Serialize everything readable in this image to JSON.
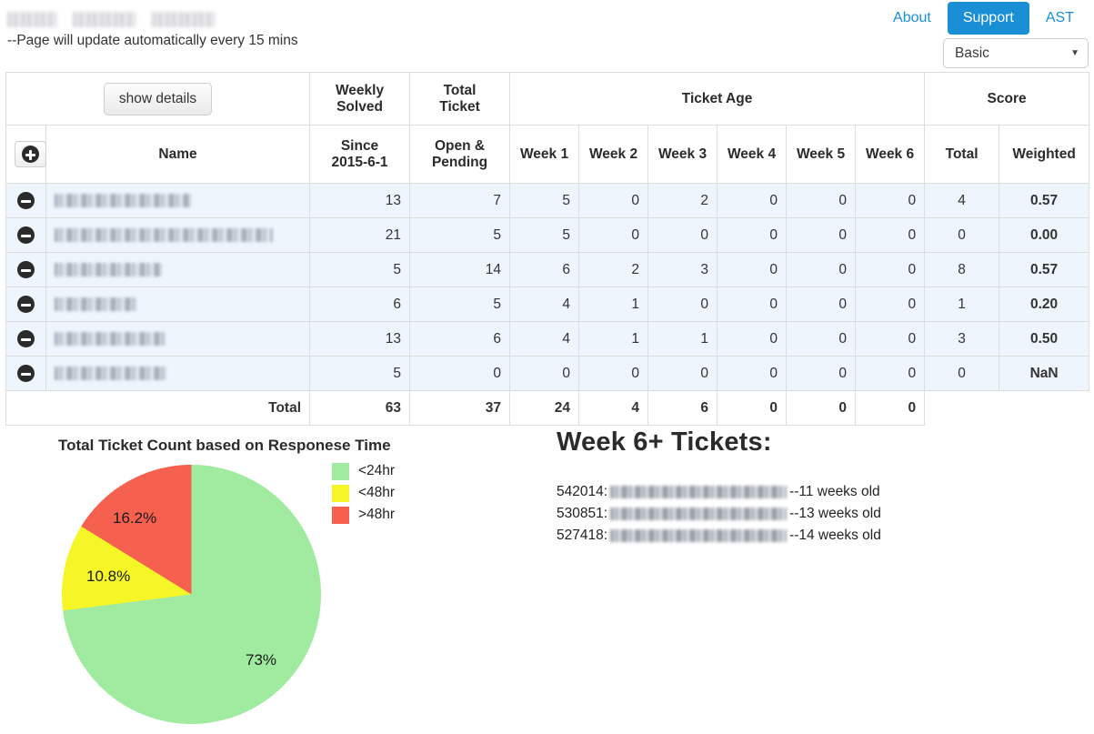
{
  "header": {
    "brand_redacted": true,
    "subnote": "--Page will update automatically every 15 mins",
    "nav": {
      "about": "About",
      "support": "Support",
      "ast": "AST"
    },
    "view_select": {
      "value": "Basic",
      "options": [
        "Basic"
      ],
      "caret": "▼"
    },
    "accent_color": "#1b8fd6"
  },
  "table": {
    "show_details_label": "show details",
    "expand_icon": "plus-circle-icon",
    "group_headers": {
      "weekly_solved": "Weekly\nSolved",
      "total_ticket": "Total\nTicket",
      "ticket_age": "Ticket Age",
      "score": "Score"
    },
    "group_headers_flat": {
      "weekly_solved_l1": "Weekly",
      "weekly_solved_l2": "Solved",
      "total_ticket_l1": "Total",
      "total_ticket_l2": "Ticket",
      "ticket_age": "Ticket Age",
      "score": "Score"
    },
    "sub_headers": {
      "name": "Name",
      "since_l1": "Since",
      "since_l2": "2015-6-1",
      "open_l1": "Open &",
      "open_l2": "Pending",
      "week1": "Week 1",
      "week2": "Week 2",
      "week3": "Week 3",
      "week4": "Week 4",
      "week5": "Week 5",
      "week6": "Week 6",
      "total": "Total",
      "weighted": "Weighted"
    },
    "rows": [
      {
        "name_redacted": true,
        "name_width": 150,
        "solved": "13",
        "open_pending": "7",
        "w1": "5",
        "w2": "0",
        "w3": "2",
        "w4": "0",
        "w5": "0",
        "w6": "0",
        "total": "4",
        "weighted": "0.57"
      },
      {
        "name_redacted": true,
        "name_width": 240,
        "solved": "21",
        "open_pending": "5",
        "w1": "5",
        "w2": "0",
        "w3": "0",
        "w4": "0",
        "w5": "0",
        "w6": "0",
        "total": "0",
        "weighted": "0.00"
      },
      {
        "name_redacted": true,
        "name_width": 118,
        "solved": "5",
        "open_pending": "14",
        "w1": "6",
        "w2": "2",
        "w3": "3",
        "w4": "0",
        "w5": "0",
        "w6": "0",
        "total": "8",
        "weighted": "0.57"
      },
      {
        "name_redacted": true,
        "name_width": 90,
        "solved": "6",
        "open_pending": "5",
        "w1": "4",
        "w2": "1",
        "w3": "0",
        "w4": "0",
        "w5": "0",
        "w6": "0",
        "total": "1",
        "weighted": "0.20"
      },
      {
        "name_redacted": true,
        "name_width": 122,
        "solved": "13",
        "open_pending": "6",
        "w1": "4",
        "w2": "1",
        "w3": "1",
        "w4": "0",
        "w5": "0",
        "w6": "0",
        "total": "3",
        "weighted": "0.50"
      },
      {
        "name_redacted": true,
        "name_width": 124,
        "solved": "5",
        "open_pending": "0",
        "w1": "0",
        "w2": "0",
        "w3": "0",
        "w4": "0",
        "w5": "0",
        "w6": "0",
        "total": "0",
        "weighted": "NaN"
      }
    ],
    "totals": {
      "label": "Total",
      "solved": "63",
      "open_pending": "37",
      "w1": "24",
      "w2": "4",
      "w3": "6",
      "w4": "0",
      "w5": "0",
      "w6": "0",
      "total": "",
      "weighted": ""
    },
    "row_bg_color": "#eef5fd",
    "collapse_icon": "minus-circle-icon"
  },
  "chart_data": {
    "type": "pie",
    "title": "Total Ticket Count based on Responese Time",
    "categories": [
      "<24hr",
      "<48hr",
      ">48hr"
    ],
    "values": [
      73,
      10.8,
      16.2
    ],
    "labels": [
      "73%",
      "10.8%",
      "16.2%"
    ],
    "colors": [
      "#a0eba0",
      "#f5f527",
      "#f5604f"
    ],
    "legend": [
      "<24hr",
      "<48hr",
      ">48hr"
    ],
    "legend_position": "right",
    "units": "percent"
  },
  "week6_panel": {
    "title": "Week 6+ Tickets:",
    "tickets": [
      {
        "id": "542014:",
        "email_redacted": true,
        "age": "--11 weeks old"
      },
      {
        "id": "530851:",
        "email_redacted": true,
        "age": "--13 weeks old"
      },
      {
        "id": "527418:",
        "email_redacted": true,
        "age": "--14 weeks old"
      }
    ]
  }
}
